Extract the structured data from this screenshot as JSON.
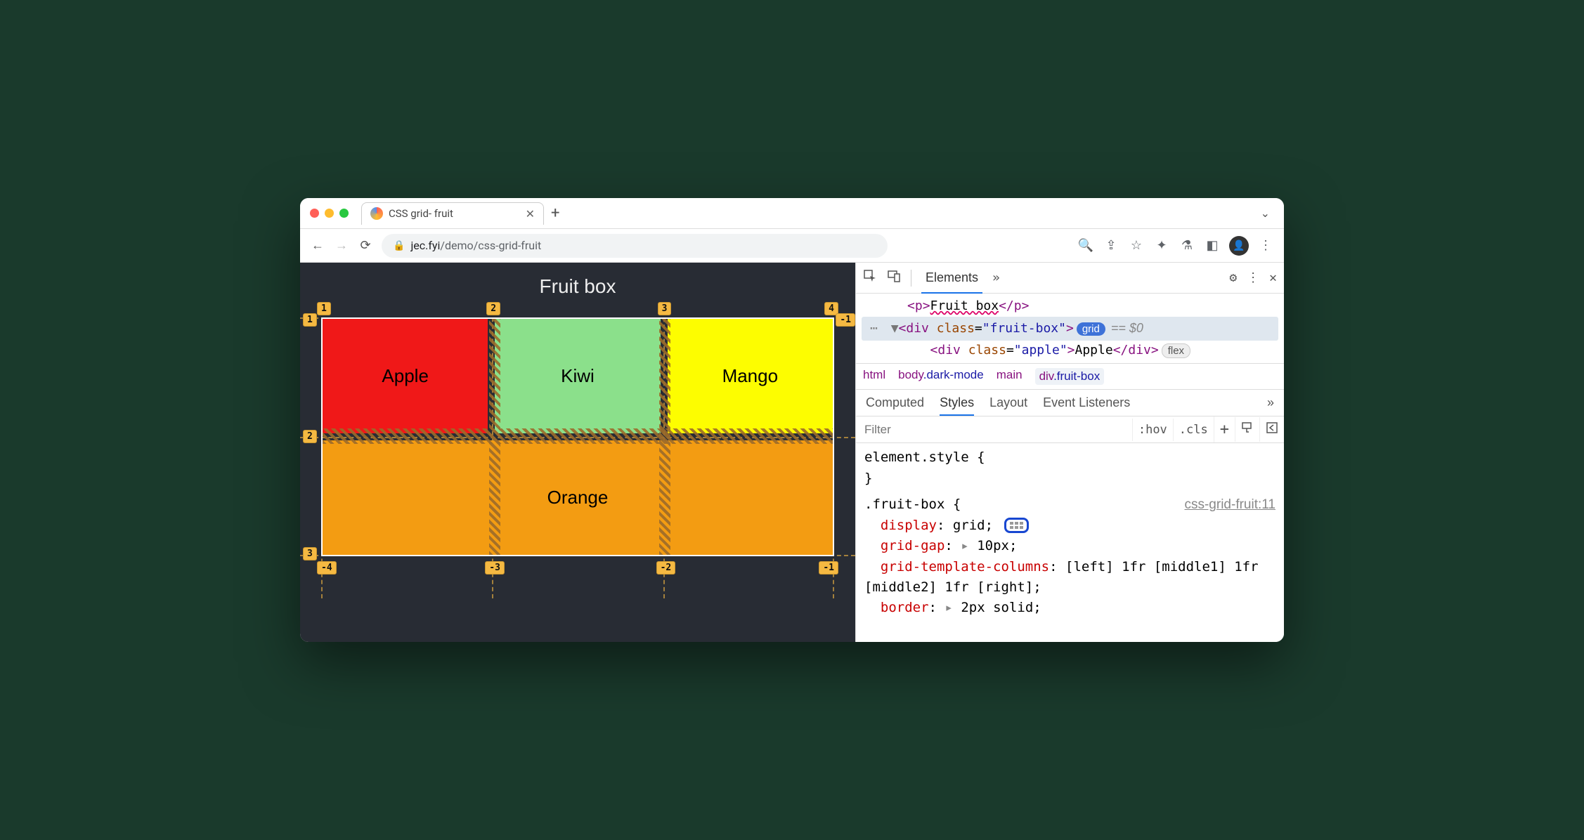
{
  "browser": {
    "tab_title": "CSS grid- fruit",
    "url_host": "jec.fyi",
    "url_path": "/demo/css-grid-fruit"
  },
  "page": {
    "heading": "Fruit box",
    "cells": {
      "apple": "Apple",
      "kiwi": "Kiwi",
      "mango": "Mango",
      "orange": "Orange"
    },
    "grid_overlay": {
      "col_positive": [
        "1",
        "2",
        "3",
        "4"
      ],
      "row_positive": [
        "1",
        "2",
        "3"
      ],
      "col_negative": [
        "-4",
        "-3",
        "-2",
        "-1"
      ],
      "row_negative_top": "-1"
    }
  },
  "devtools": {
    "main_tabs": {
      "elements": "Elements"
    },
    "dom": {
      "line1_text": "Fruit box",
      "line2_class": "fruit-box",
      "line2_badge": "grid",
      "line2_eq": "== $0",
      "line3_class": "apple",
      "line3_text": "Apple",
      "line3_badge": "flex"
    },
    "breadcrumb": [
      "html",
      "body.dark-mode",
      "main",
      "div.fruit-box"
    ],
    "sub_tabs": [
      "Computed",
      "Styles",
      "Layout",
      "Event Listeners"
    ],
    "sub_active": "Styles",
    "filter_placeholder": "Filter",
    "filter_buttons": [
      ":hov",
      ".cls",
      "+"
    ],
    "styles": {
      "element_style_open": "element.style {",
      "element_style_close": "}",
      "rule_selector": ".fruit-box {",
      "rule_source": "css-grid-fruit:11",
      "props": {
        "display": {
          "name": "display",
          "value": "grid;"
        },
        "gap": {
          "name": "grid-gap",
          "value": "10px;"
        },
        "cols": {
          "name": "grid-template-columns",
          "value": "[left] 1fr [middle1] 1fr [middle2] 1fr [right];"
        },
        "border": {
          "name": "border",
          "value": "2px solid;"
        }
      }
    }
  }
}
